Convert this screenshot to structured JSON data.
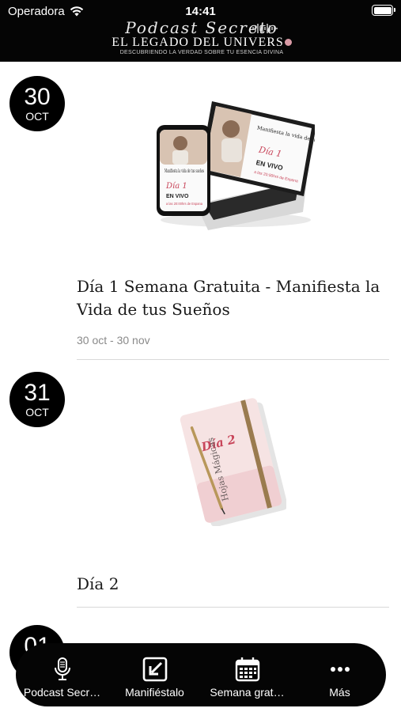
{
  "status_bar": {
    "carrier": "Operadora",
    "time": "14:41"
  },
  "header": {
    "logo_script": "Podcast Secreto",
    "logo_main": "EL LEGADO DEL UNIVERS",
    "logo_tagline": "DESCUBRIENDO LA VERDAD SOBRE TU ESENCIA DIVINA"
  },
  "feed": {
    "items": [
      {
        "day": "30",
        "month": "OCT",
        "title": "Día 1 Semana Gratuita - Manifiesta la Vida de tus Sueños",
        "date_range": "30 oct - 30 nov",
        "image": {
          "headline": "Manifiesta la vida de tus sueños",
          "badge": "Día 1",
          "live": "EN VIVO",
          "live_detail": "a las 20:00hrs de Espana"
        }
      },
      {
        "day": "31",
        "month": "OCT",
        "title": "Día 2",
        "image": {
          "badge": "Día 2",
          "subtitle": "Hojas Mágicas"
        }
      },
      {
        "day": "01"
      }
    ]
  },
  "tab_bar": {
    "tabs": [
      {
        "label": "Podcast Secr…",
        "icon": "microphone-icon"
      },
      {
        "label": "Manifiéstalo",
        "icon": "external-link-icon"
      },
      {
        "label": "Semana grat…",
        "icon": "calendar-icon"
      },
      {
        "label": "Más",
        "icon": "more-dots-icon"
      }
    ]
  },
  "colors": {
    "header_bg": "#050505",
    "accent_pink": "#d99aa5",
    "brand_red": "#c8455a"
  }
}
